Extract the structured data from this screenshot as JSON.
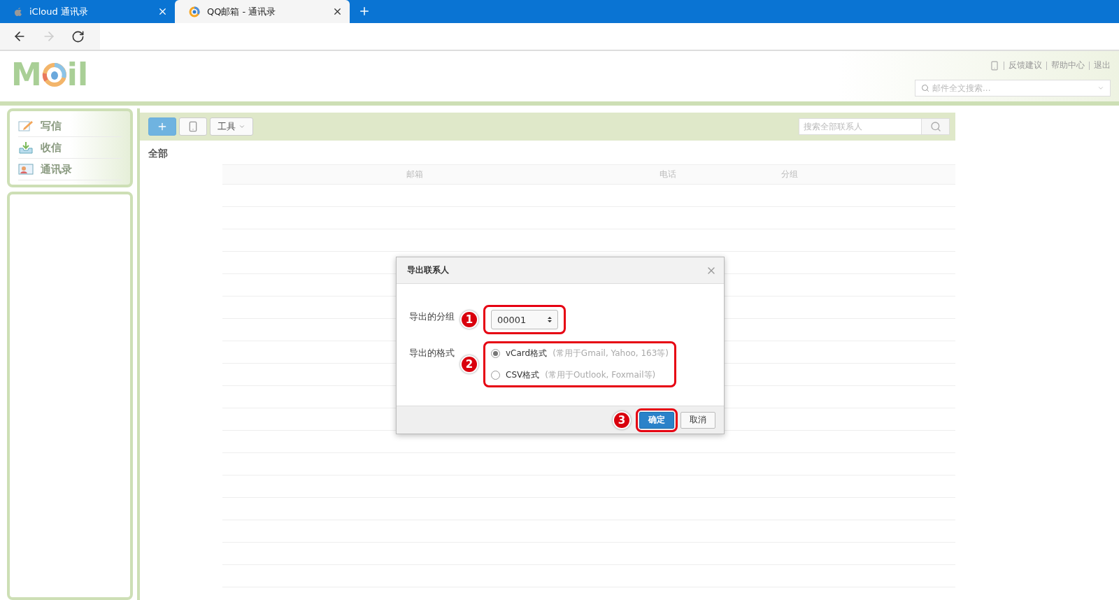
{
  "browser": {
    "tabs": [
      {
        "title": "iCloud 通讯录",
        "selected": false
      },
      {
        "title": "QQ邮箱 - 通讯录",
        "selected": true
      }
    ]
  },
  "header": {
    "logo": [
      "M",
      "il"
    ],
    "links": [
      "反馈建议",
      "帮助中心",
      "退出"
    ],
    "search": {
      "placeholder": "邮件全文搜索..."
    }
  },
  "sidebar": {
    "items": [
      {
        "label": "写信"
      },
      {
        "label": "收信"
      },
      {
        "label": "通讯录"
      }
    ]
  },
  "toolbar": {
    "tools_label": "工具",
    "search": {
      "placeholder": "搜索全部联系人"
    }
  },
  "list": {
    "title": "全部",
    "columns": [
      "邮箱",
      "电话",
      "分组"
    ]
  },
  "dialog": {
    "title": "导出联系人",
    "group_label": "导出的分组",
    "group_value": "00001",
    "format_label": "导出的格式",
    "formats": [
      {
        "label": "vCard格式",
        "note": "(常用于Gmail, Yahoo, 163等)",
        "selected": true
      },
      {
        "label": "CSV格式",
        "note": "(常用于Outlook, Foxmail等)",
        "selected": false
      }
    ],
    "buttons": [
      {
        "label": "确定",
        "kind": "primary"
      },
      {
        "label": "取消",
        "kind": "default"
      }
    ]
  },
  "annotations": [
    "1",
    "2",
    "3"
  ]
}
